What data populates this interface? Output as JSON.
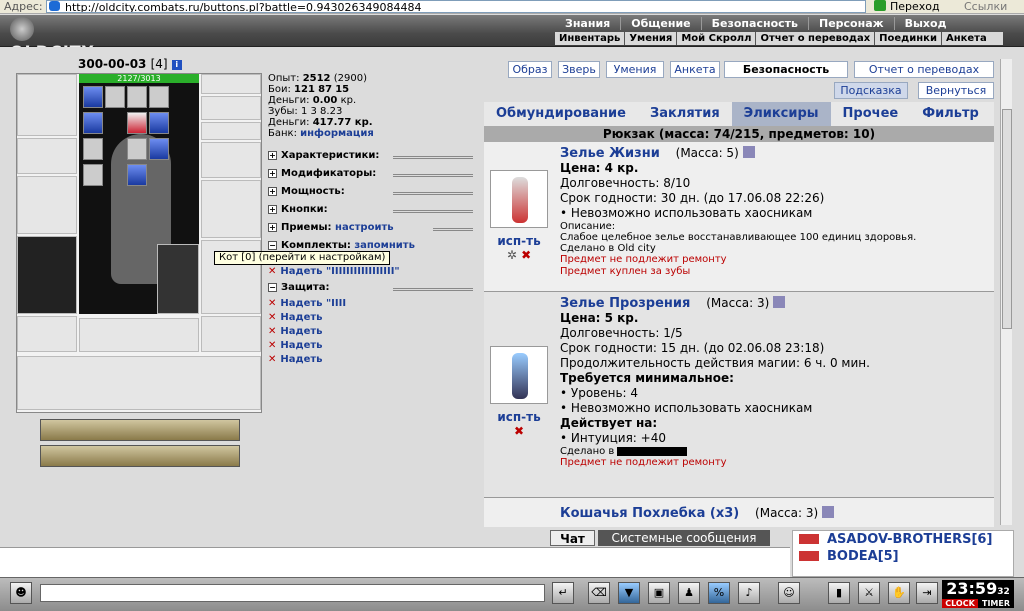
{
  "browser": {
    "address_label": "Адрес:",
    "url": "http://oldcity.combats.ru/buttons.pl?battle=0.943026349084484",
    "go_label": "Переход",
    "links_label": "Ссылки"
  },
  "header": {
    "logo": "OLDCITY",
    "topmenu": [
      "Знания",
      "Общение",
      "Безопасность",
      "Персонаж",
      "Выход"
    ],
    "submenu": [
      "Инвентарь",
      "Умения",
      "Мой Скролл",
      "Отчет о переводах",
      "Поединки",
      "Анкета"
    ]
  },
  "player": {
    "name": "300-00-03",
    "level": "[4]",
    "info_icon": "i",
    "hp": "2127/3013"
  },
  "stats": {
    "exp_label": "Опыт:",
    "exp": "2512",
    "exp_next": "(2900)",
    "battles_label": "Бои:",
    "battles": "121",
    "battles2": "87",
    "battles3": "15",
    "money_label": "Деньги:",
    "money": "0.00",
    "money_unit": "кр.",
    "teeth_label": "Зубы:",
    "teeth": "1 3 8.23",
    "money2_label": "Деньги:",
    "money2": "417.77 кр.",
    "bank_label": "Банк:",
    "bank_link": "информация"
  },
  "sections": [
    {
      "label": "Характеристики:"
    },
    {
      "label": "Модификаторы:"
    },
    {
      "label": "Мощность:"
    },
    {
      "label": "Кнопки:"
    },
    {
      "label": "Приемы:",
      "link": "настроить"
    },
    {
      "label": "Комплекты:",
      "link": "запомнить"
    }
  ],
  "tooltip": "Кот [0] (перейти к настройкам)",
  "kit_action": "Надеть \"IIIIIIIIIIIIIIIII\"",
  "defense_label": "Защита:",
  "defense_actions": [
    "Надеть \"IIII",
    "Надеть",
    "Надеть",
    "Надеть",
    "Надеть"
  ],
  "top_buttons": [
    "Образ",
    "Зверь",
    "Умения",
    "Анкета",
    "Безопасность",
    "Отчет о переводах",
    "Подсказка",
    "Вернуться"
  ],
  "tabs": [
    "Обмундирование",
    "Заклятия",
    "Эликсиры",
    "Прочее",
    "Фильтр"
  ],
  "active_tab": "Эликсиры",
  "bag_header": "Рюкзак (масса: 74/215, предметов: 10)",
  "items": [
    {
      "name": "Зелье Жизни",
      "mass": "(Масса: 5)",
      "lines": [
        "Цена: 4 кр.",
        "Долговечность: 8/10",
        "Срок годности: 30 дн. (до 17.06.08 22:26)",
        "• Невозможно использовать хаосникам"
      ],
      "small": [
        "Описание:",
        "Слабое целебное зелье восстанавливающее 100 единиц здоровья.",
        "Сделано в Old city"
      ],
      "red": [
        "Предмет не подлежит ремонту",
        "Предмет куплен за зубы"
      ],
      "use": "исп-ть"
    },
    {
      "name": "Зелье Прозрения",
      "mass": "(Масса: 3)",
      "lines": [
        "Цена: 5 кр.",
        "Долговечность: 1/5",
        "Срок годности: 15 дн. (до 02.06.08 23:18)",
        "Продолжительность действия магии: 6 ч. 0 мин.",
        "Требуется минимальное:",
        "• Уровень: 4",
        "• Невозможно использовать хаосникам",
        "Действует на:",
        "• Интуиция: +40"
      ],
      "made": "Сделано в",
      "red": [
        "Предмет не подлежит ремонту"
      ],
      "use": "исп-ть"
    },
    {
      "name": "Кошачья Похлебка (x3)",
      "mass": "(Масса: 3)"
    }
  ],
  "chat": {
    "tab1": "Чат",
    "tab2": "Системные сообщения"
  },
  "online": [
    "ASADOV-BROTHERS[6]",
    "BODEA[5]"
  ],
  "clock": {
    "time": "23:59",
    "sec": "32",
    "clock_lbl": "CLOCK",
    "timer_lbl": "TIMER"
  }
}
